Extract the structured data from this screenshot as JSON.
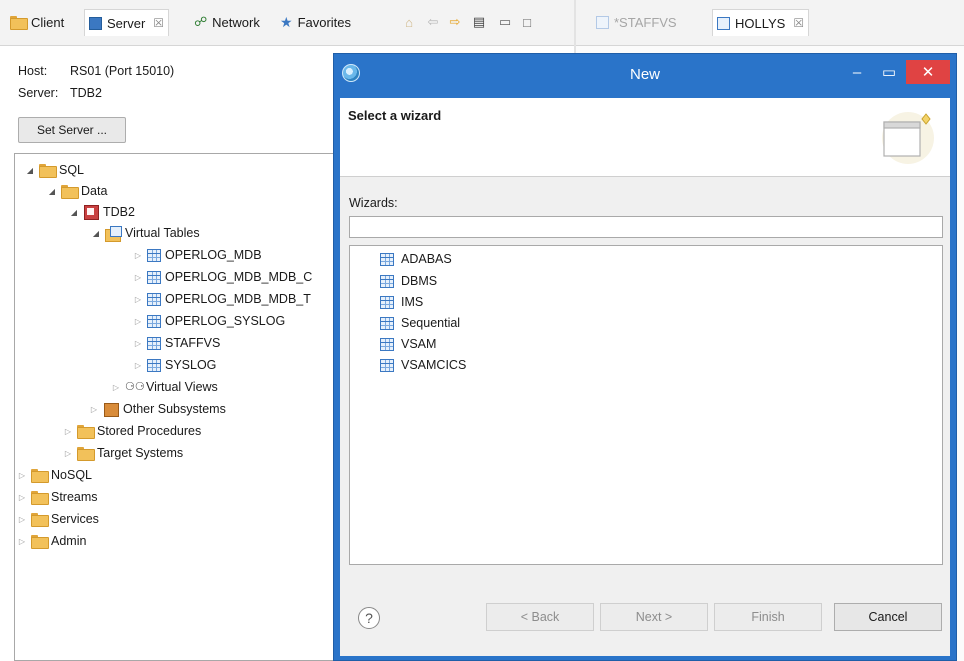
{
  "tabs_left": {
    "client": "Client",
    "server": "Server",
    "network": "Network",
    "favorites": "Favorites",
    "close_glyph": "☒"
  },
  "tabs_right": {
    "staffvs": "*STAFFVS",
    "hollys": "HOLLYS",
    "close_glyph": "☒"
  },
  "server_info": {
    "host_label": "Host:",
    "host_value": "RS01 (Port 15010)",
    "server_label": "Server:",
    "server_value": "TDB2",
    "set_server_button": "Set Server ..."
  },
  "tree": [
    {
      "label": "SQL"
    },
    {
      "label": "Data"
    },
    {
      "label": "TDB2"
    },
    {
      "label": "Virtual Tables"
    },
    {
      "label": "OPERLOG_MDB"
    },
    {
      "label": "OPERLOG_MDB_MDB_C"
    },
    {
      "label": "OPERLOG_MDB_MDB_T"
    },
    {
      "label": "OPERLOG_SYSLOG"
    },
    {
      "label": "STAFFVS"
    },
    {
      "label": "SYSLOG"
    },
    {
      "label": "Virtual Views"
    },
    {
      "label": "Other Subsystems"
    },
    {
      "label": "Stored Procedures"
    },
    {
      "label": "Target Systems"
    },
    {
      "label": "NoSQL"
    },
    {
      "label": "Streams"
    },
    {
      "label": "Services"
    },
    {
      "label": "Admin"
    }
  ],
  "dialog": {
    "title": "New",
    "header": "Select a wizard",
    "wizards_label": "Wizards:",
    "filter_value": "",
    "wizards": [
      "ADABAS",
      "DBMS",
      "IMS",
      "Sequential",
      "VSAM",
      "VSAMCICS"
    ],
    "buttons": {
      "back": "< Back",
      "next": "Next >",
      "finish": "Finish",
      "cancel": "Cancel"
    },
    "help": "?"
  },
  "colors": {
    "dialog_frame": "#2a74c9",
    "close_button": "#e04343",
    "folder": "#f2c15a"
  }
}
